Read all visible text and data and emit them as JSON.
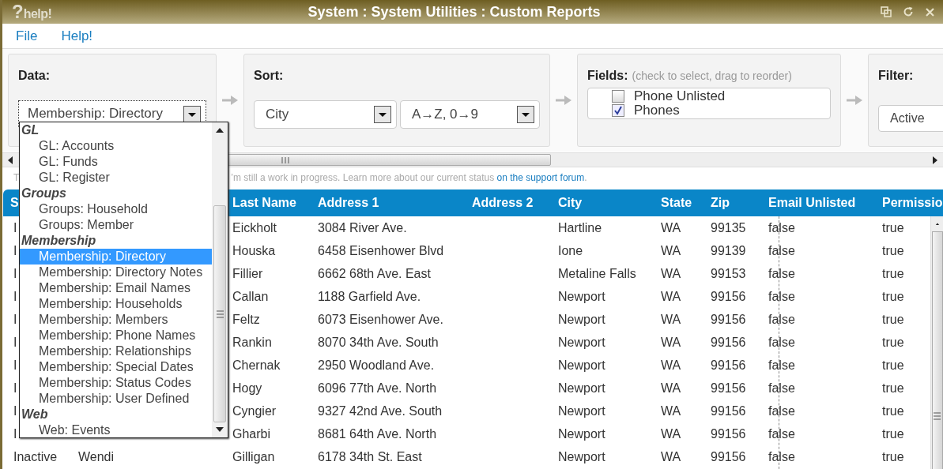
{
  "window": {
    "logo_mark": "?",
    "logo_text": "help!",
    "title": "System : System Utilities : Custom Reports"
  },
  "menu": [
    "File",
    "Help!"
  ],
  "data_panel": {
    "label": "Data:",
    "value": "Membership: Directory",
    "options": [
      {
        "kind": "group",
        "label": "GL"
      },
      {
        "kind": "item",
        "label": "GL: Accounts",
        "selected": false
      },
      {
        "kind": "item",
        "label": "GL: Funds",
        "selected": false
      },
      {
        "kind": "item",
        "label": "GL: Register",
        "selected": false
      },
      {
        "kind": "group",
        "label": "Groups"
      },
      {
        "kind": "item",
        "label": "Groups: Household",
        "selected": false
      },
      {
        "kind": "item",
        "label": "Groups: Member",
        "selected": false
      },
      {
        "kind": "group",
        "label": "Membership"
      },
      {
        "kind": "item",
        "label": "Membership: Directory",
        "selected": true
      },
      {
        "kind": "item",
        "label": "Membership: Directory Notes",
        "selected": false
      },
      {
        "kind": "item",
        "label": "Membership: Email Names",
        "selected": false
      },
      {
        "kind": "item",
        "label": "Membership: Households",
        "selected": false
      },
      {
        "kind": "item",
        "label": "Membership: Members",
        "selected": false
      },
      {
        "kind": "item",
        "label": "Membership: Phone Names",
        "selected": false
      },
      {
        "kind": "item",
        "label": "Membership: Relationships",
        "selected": false
      },
      {
        "kind": "item",
        "label": "Membership: Special Dates",
        "selected": false
      },
      {
        "kind": "item",
        "label": "Membership: Status Codes",
        "selected": false
      },
      {
        "kind": "item",
        "label": "Membership: User Defined",
        "selected": false
      },
      {
        "kind": "group",
        "label": "Web"
      },
      {
        "kind": "item",
        "label": "Web: Events",
        "selected": false
      }
    ]
  },
  "sort_panel": {
    "label": "Sort:",
    "field": "City",
    "order": "A→Z, 0→9"
  },
  "fields_panel": {
    "label": "Fields:",
    "hint": "(check to select, drag to reorder)",
    "items": [
      {
        "label": "Phone Unlisted",
        "checked": false
      },
      {
        "label": "Phones",
        "checked": true
      }
    ]
  },
  "filter_panel": {
    "label": "Filter:",
    "value": "Active"
  },
  "notice": {
    "lead": "T",
    "text": "’m still a work in progress. Learn more about our current status",
    "link": "on the support forum",
    "tail": "."
  },
  "table": {
    "columns": [
      "S",
      "Last Name",
      "Address 1",
      "Address 2",
      "City",
      "State",
      "Zip",
      "Email Unlisted",
      "Permissio"
    ],
    "rows": [
      {
        "status": "I",
        "last_name": "Eickholt",
        "address_1": "3084 River Ave.",
        "city": "Hartline",
        "state": "WA",
        "zip": "99135",
        "email_unlisted": "false",
        "permissions": "true"
      },
      {
        "status": "I",
        "last_name": "Houska",
        "address_1": "6458 Eisenhower Blvd",
        "city": "Ione",
        "state": "WA",
        "zip": "99139",
        "email_unlisted": "false",
        "permissions": "true"
      },
      {
        "status": "I",
        "last_name": "Fillier",
        "address_1": "6662 68th Ave. East",
        "city": "Metaline Falls",
        "state": "WA",
        "zip": "99153",
        "email_unlisted": "false",
        "permissions": "true"
      },
      {
        "status": "I",
        "last_name": "Callan",
        "address_1": "1188 Garfield Ave.",
        "city": "Newport",
        "state": "WA",
        "zip": "99156",
        "email_unlisted": "false",
        "permissions": "true"
      },
      {
        "status": "I",
        "last_name": "Feltz",
        "address_1": "6073 Eisenhower Ave.",
        "city": "Newport",
        "state": "WA",
        "zip": "99156",
        "email_unlisted": "false",
        "permissions": "true"
      },
      {
        "status": "I",
        "last_name": "Rankin",
        "address_1": "8070 34th Ave. South",
        "city": "Newport",
        "state": "WA",
        "zip": "99156",
        "email_unlisted": "false",
        "permissions": "true"
      },
      {
        "status": "I",
        "last_name": "Chernak",
        "address_1": "2950 Woodland Ave.",
        "city": "Newport",
        "state": "WA",
        "zip": "99156",
        "email_unlisted": "false",
        "permissions": "true"
      },
      {
        "status": "I",
        "last_name": "Hogy",
        "address_1": "6096 77th Ave. North",
        "city": "Newport",
        "state": "WA",
        "zip": "99156",
        "email_unlisted": "false",
        "permissions": "true"
      },
      {
        "status": "I",
        "last_name": "Cyngier",
        "address_1": "9327 42nd Ave. South",
        "city": "Newport",
        "state": "WA",
        "zip": "99156",
        "email_unlisted": "false",
        "permissions": "true"
      },
      {
        "status": "I",
        "last_name": "Gharbi",
        "address_1": "8681 64th Ave. North",
        "city": "Newport",
        "state": "WA",
        "zip": "99156",
        "email_unlisted": "false",
        "permissions": "true"
      },
      {
        "status": "Inactive",
        "first_name": "Wendi",
        "last_name": "Gilligan",
        "address_1": "6178 34th St. East",
        "city": "Newport",
        "state": "WA",
        "zip": "99156",
        "email_unlisted": "false",
        "permissions": "true"
      }
    ]
  }
}
